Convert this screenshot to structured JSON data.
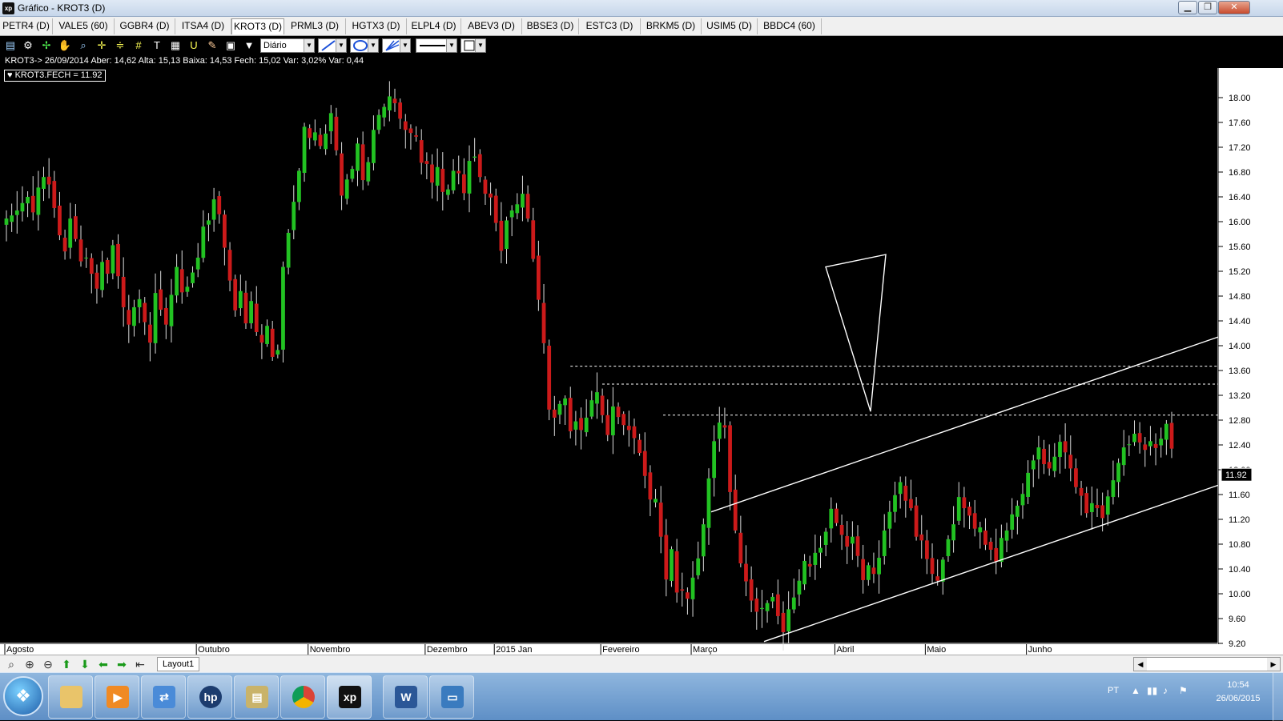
{
  "window": {
    "app_icon": "xp",
    "title": "Gráfico - KROT3 (D)",
    "minimize": "▁",
    "maximize": "❐",
    "close": "✕"
  },
  "tabs": [
    "PETR4 (D)",
    "VALE5 (60)",
    "GGBR4 (D)",
    "ITSA4 (D)",
    "KROT3 (D)",
    "PRML3 (D)",
    "HGTX3 (D)",
    "ELPL4 (D)",
    "ABEV3 (D)",
    "BBSE3 (D)",
    "ESTC3 (D)",
    "BRKM5 (D)",
    "USIM5 (D)",
    "BBDC4 (60)"
  ],
  "active_tab": "KROT3 (D)",
  "toolbar": {
    "icons": [
      "chart-icon",
      "gear-icon",
      "cursor-icon",
      "hand-icon",
      "zoom-chart-icon",
      "crosshair-icon",
      "fibonacci-icon",
      "grid-icon",
      "text-icon",
      "magnet-icon",
      "brush-icon",
      "calculator-icon",
      "clipboard-icon",
      "filter-icon"
    ],
    "period": "Diário"
  },
  "info_line": "KROT3-> 26/09/2014 Aber: 14,62 Alta: 15,13 Baixa: 14,53 Fech: 15,02 Var: 3,02% Var: 0,44",
  "legend": "♥ KROT3.FECH = 11.92",
  "bottom": {
    "layout_tab": "Layout1"
  },
  "taskbar": {
    "start_icon": "windows-start-icon",
    "apps": [
      "explorer-icon",
      "media-player-icon",
      "network-icon",
      "hp-icon",
      "archive-icon",
      "chrome-icon",
      "xp-icon",
      "word-icon",
      "image-viewer-icon"
    ],
    "lang": "PT",
    "time": "10:54",
    "date": "26/06/2015"
  },
  "colors": {
    "bull": "#22c222",
    "bear": "#cc1a1a",
    "axis": "#ffffff",
    "grid_line": "#ffffff",
    "background": "#000000"
  },
  "chart_data": {
    "type": "candlestick",
    "symbol": "KROT3",
    "period": "D",
    "last_price": 11.92,
    "last_price_label": "11.92",
    "ylim": [
      9.2,
      18.4
    ],
    "y_ticks": [
      "9.20",
      "9.60",
      "10.00",
      "10.40",
      "10.80",
      "11.20",
      "11.60",
      "12.00",
      "12.40",
      "12.80",
      "13.20",
      "13.60",
      "14.00",
      "14.40",
      "14.80",
      "15.20",
      "15.60",
      "16.00",
      "16.40",
      "16.80",
      "17.20",
      "17.60",
      "18.00"
    ],
    "x_months": [
      "Agosto",
      "Outubro",
      "Novembro",
      "Dezembro",
      "2015 Jan",
      "Fevereiro",
      "Março",
      "Abril",
      "Maio",
      "Junho"
    ],
    "month_bar_index": [
      0,
      36,
      57,
      79,
      92,
      112,
      129,
      156,
      173,
      192
    ],
    "closes": [
      16.05,
      16.1,
      16.18,
      16.3,
      16.4,
      16.15,
      16.55,
      16.72,
      16.6,
      16.22,
      15.78,
      15.52,
      16.05,
      15.72,
      15.36,
      15.42,
      15.16,
      14.92,
      15.35,
      15.16,
      15.62,
      15.12,
      14.62,
      14.34,
      14.62,
      14.75,
      14.38,
      14.05,
      14.85,
      14.58,
      14.34,
      14.82,
      15.27,
      14.86,
      14.95,
      15.18,
      15.42,
      15.92,
      16.02,
      16.36,
      16.12,
      15.58,
      15.05,
      14.57,
      14.88,
      14.36,
      14.72,
      14.22,
      14.05,
      14.32,
      13.82,
      13.93,
      15.27,
      15.82,
      16.32,
      16.82,
      17.53,
      17.35,
      17.44,
      17.22,
      17.42,
      17.75,
      17.15,
      16.42,
      16.68,
      16.85,
      17.26,
      16.67,
      16.96,
      17.48,
      17.72,
      17.85,
      18.02,
      17.91,
      17.66,
      17.48,
      17.43,
      17.37,
      16.95,
      16.93,
      16.63,
      16.88,
      16.48,
      16.52,
      16.82,
      16.78,
      16.46,
      16.98,
      17.05,
      16.72,
      16.45,
      16.39,
      15.98,
      15.53,
      16.02,
      16.18,
      16.28,
      16.45,
      16.05,
      15.4,
      14.74,
      14.04,
      12.97,
      12.84,
      13.06,
      13.15,
      12.62,
      12.78,
      12.64,
      12.84,
      13.12,
      13.25,
      12.88,
      12.56,
      13.02,
      12.85,
      12.72,
      12.64,
      12.51,
      12.27,
      11.9,
      11.52,
      11.53,
      10.92,
      10.23,
      10.72,
      10.02,
      10.05,
      9.92,
      10.26,
      10.57,
      11.12,
      11.86,
      12.46,
      12.76,
      12.68,
      11.64,
      11.02,
      10.49,
      10.2,
      9.89,
      9.71,
      9.77,
      9.85,
      9.95,
      9.64,
      9.38,
      9.75,
      9.94,
      10.21,
      10.53,
      10.44,
      10.66,
      10.74,
      11.0,
      11.37,
      11.14,
      10.95,
      10.76,
      10.92,
      10.61,
      10.22,
      10.46,
      10.32,
      10.58,
      11.02,
      11.32,
      11.59,
      11.8,
      11.5,
      11.38,
      10.92,
      10.86,
      10.56,
      10.32,
      10.21,
      10.55,
      10.88,
      11.12,
      11.56,
      11.38,
      11.26,
      11.05,
      11.07,
      10.79,
      10.71,
      10.52,
      10.9,
      11.02,
      11.28,
      11.42,
      11.61,
      11.95,
      12.15,
      12.36,
      12.09,
      12.02,
      12.21,
      12.45,
      12.28,
      12.02,
      11.72,
      11.58,
      11.3,
      11.46,
      11.38,
      11.22,
      11.57,
      11.83,
      12.11,
      12.36,
      12.41,
      12.58,
      12.44,
      12.32,
      12.46,
      12.35,
      12.5,
      12.74,
      12.34
    ]
  }
}
